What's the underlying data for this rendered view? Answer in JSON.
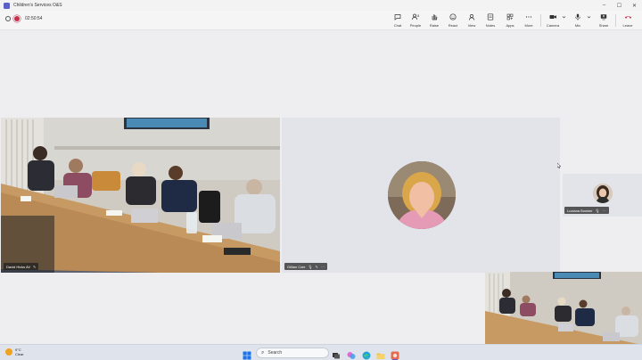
{
  "window": {
    "title": "Children's Services O&S",
    "controls": {
      "minimize": "–",
      "maximize": "☐",
      "close": "✕"
    }
  },
  "meeting": {
    "elapsed": "02:50:54",
    "recording": true,
    "accent_color": "#5b5fc7",
    "record_color": "#c4314b"
  },
  "toolbar": {
    "buttons": [
      {
        "label": "Chat",
        "icon": "chat-icon"
      },
      {
        "label": "People",
        "icon": "people-icon",
        "count": "8"
      },
      {
        "label": "Raise",
        "icon": "raise-hand-icon"
      },
      {
        "label": "React",
        "icon": "react-icon"
      },
      {
        "label": "View",
        "icon": "view-icon"
      },
      {
        "label": "Notes",
        "icon": "notes-icon"
      },
      {
        "label": "Apps",
        "icon": "apps-icon"
      },
      {
        "label": "More",
        "icon": "more-icon"
      },
      {
        "label": "Camera",
        "icon": "camera-icon"
      },
      {
        "label": "Mic",
        "icon": "mic-icon"
      },
      {
        "label": "Share",
        "icon": "share-icon"
      },
      {
        "label": "Leave",
        "icon": "leave-icon"
      }
    ]
  },
  "participants": [
    {
      "name": "David Hicks AV",
      "type": "room-video"
    },
    {
      "name": "Gillian Cole",
      "type": "avatar"
    },
    {
      "name": "Luciana Bowker",
      "type": "avatar"
    }
  ],
  "taskbar": {
    "weather": {
      "temp": "9°C",
      "condition": "Clear"
    },
    "search_placeholder": "Search",
    "apps": [
      "task-view-icon",
      "copilot-icon",
      "edge-icon",
      "file-explorer-icon",
      "photos-icon",
      "teams-icon"
    ]
  }
}
